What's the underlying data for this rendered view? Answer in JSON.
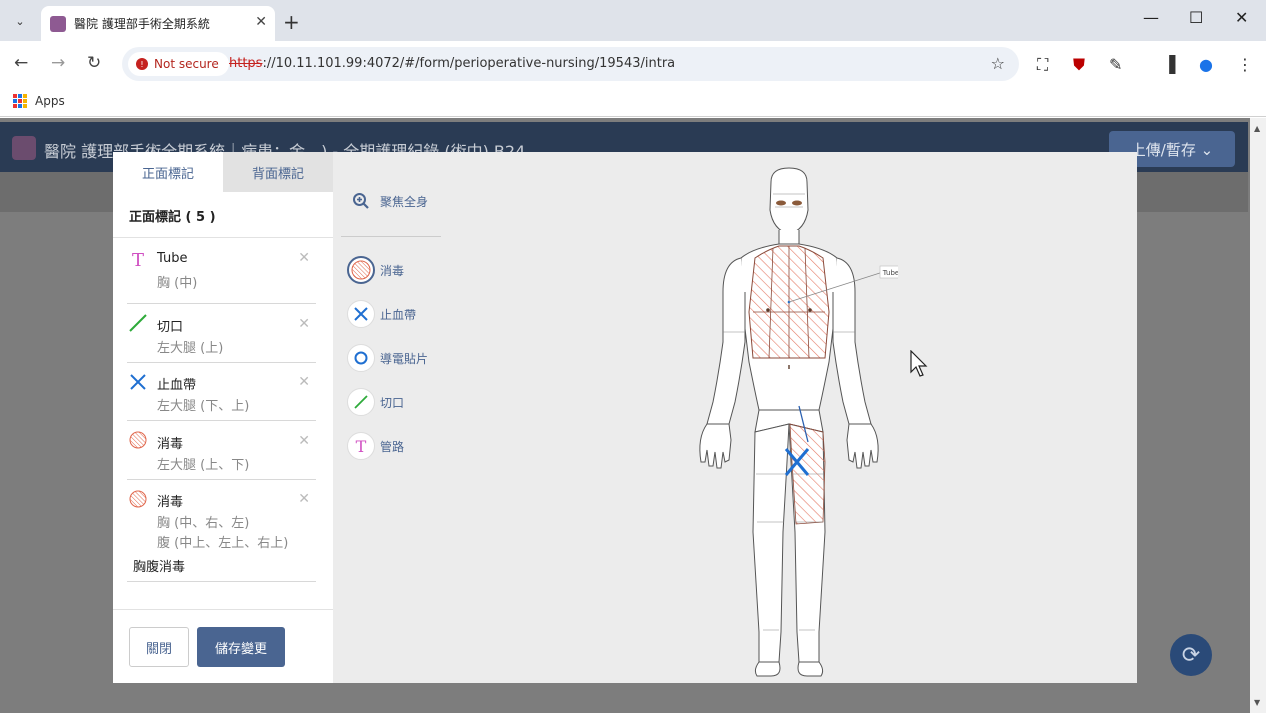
{
  "browser": {
    "tab_title": "醫院 護理部手術全期系統",
    "url_scheme": "https",
    "url_rest": "://10.11.101.99:4072/#/form/perioperative-nursing/19543/intra",
    "security_label": "Not secure",
    "bookmarks_apps": "Apps"
  },
  "app": {
    "title": "醫院 護理部手術全期系統｜病患：金　) - 全期護理紀錄 (術中) B24",
    "upload_label": "上傳/暫存 ⌄"
  },
  "modal": {
    "tabs": {
      "front": "正面標記",
      "back": "背面標記"
    },
    "marks_header": "正面標記 ( 5 )",
    "marks": [
      {
        "type": "tube",
        "name": "Tube",
        "locations": [
          "胸 (中)"
        ],
        "note": ""
      },
      {
        "type": "incision",
        "name": "切口",
        "locations": [
          "左大腿 (上)"
        ],
        "note": ""
      },
      {
        "type": "tourniquet",
        "name": "止血帶",
        "locations": [
          "左大腿 (下、上)"
        ],
        "note": ""
      },
      {
        "type": "disinfection",
        "name": "消毒",
        "locations": [
          "左大腿 (上、下)"
        ],
        "note": ""
      },
      {
        "type": "disinfection",
        "name": "消毒",
        "locations": [
          "胸 (中、右、左)",
          "腹 (中上、左上、右上)"
        ],
        "note": "胸腹消毒"
      }
    ],
    "close_label": "關閉",
    "save_label": "儲存變更",
    "tools": {
      "focus": "聚焦全身",
      "disinfection": "消毒",
      "tourniquet": "止血帶",
      "grounding_pad": "導電貼片",
      "incision": "切口",
      "tube": "管路"
    },
    "figure_tube_label": "Tube"
  },
  "colors": {
    "primary": "#4a6591",
    "disinfection": "#e0654a",
    "tourniquet": "#1f6fd1",
    "incision": "#2eaa3a",
    "tube": "#d04fc2"
  }
}
